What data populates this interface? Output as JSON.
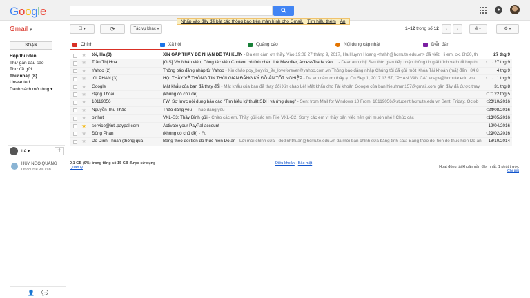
{
  "header": {
    "logo": "Google",
    "search_value": "",
    "promo_text": "Nhấp vào đây để bật các thông báo trên màn hình cho Gmail.",
    "promo_learn": "Tìm hiểu thêm",
    "promo_hide": "Ẩn"
  },
  "app": {
    "label": "Gmail",
    "label_arrow": "▾"
  },
  "toolbar": {
    "select_label": "☐ ▾",
    "refresh_label": "⟳",
    "more_label": "Tác vụ khác ▾",
    "pager_range": "1–12",
    "pager_of": "trong số",
    "pager_total": "12",
    "lang_label": "ê ▾",
    "settings_label": "⚙ ▾"
  },
  "sidebar": {
    "compose": "SOẠN",
    "items": [
      {
        "label": "Hộp thư đến",
        "active": true
      },
      {
        "label": "Thư gắn dấu sao",
        "active": false
      },
      {
        "label": "Thư đã gửi",
        "active": false
      },
      {
        "label": "Thư nháp (8)",
        "active": true
      },
      {
        "label": "Unwanted",
        "active": false
      },
      {
        "label": "Danh sách mở rộng ▾",
        "active": false
      }
    ],
    "hangouts_me": "Lê ▾",
    "contact_name": "HUY NGO QUANG",
    "contact_status": "Of course we can"
  },
  "tabs": [
    {
      "label": "Chính",
      "color": "#d93025"
    },
    {
      "label": "Xã hội",
      "color": "#1a73e8"
    },
    {
      "label": "Quảng cáo",
      "color": "#188038"
    },
    {
      "label": "Nội dung cập nhật",
      "color": "#e37400"
    },
    {
      "label": "Diễn đàn",
      "color": "#7b1fa2"
    }
  ],
  "emails": [
    {
      "sender": "tôi, Ha (3)",
      "subject": "XIN GẤP THẦY ĐỀ NHẬN ĐỀ TÀI KLTN",
      "snippet": " - Da em cảm ơn thầy. Vào 19:08 27 tháng 9, 2017, Ha Huynh Hoang <hahh@hcmute.edu.vn> đã viết: Hi em, ok. 8h30, th",
      "date": "27 thg 9",
      "unread": true,
      "starred": false,
      "attach": false
    },
    {
      "sender": "Trần Thị Hoa",
      "subject": "[G.S] V/v Nhân viên, Công tác viên Content có tính chén link Masoffer, AccessTrade vào ...",
      "snippet": " - Dear anh,chị! Sau thời gian tiếp nhận thông tin giải trình và buổi họp th",
      "date": "27 thg 9",
      "unread": false,
      "starred": false,
      "attach": true
    },
    {
      "sender": "Yahoo (2)",
      "subject": "Thông báo đăng nhập từ Yahoo",
      "snippet": " - Xin chào poy_boyvip_9x_loveforever@yahoo.com.vn Thông báo đăng nhập Chúng tôi đã gửi mớt Khóa Tài khoản (mã) đến +84 8",
      "date": "4 thg 9",
      "unread": false,
      "starred": false,
      "attach": false
    },
    {
      "sender": "tôi, PHAN (3)",
      "subject": "HỌI THẦY VỀ THÔNG TIN THỜI GIAN ĐĂNG KÝ ĐỒ ÁN TỐT NGHIỆP",
      "snippet": " - Da em cảm ơn thầy ạ. On Sep 1, 2017 13:57, \"PHAN VAN CA\" <capv@hcmute.edu.vn>",
      "date": "1 thg 9",
      "unread": false,
      "starred": false,
      "attach": true
    },
    {
      "sender": "Google",
      "subject": "Mật khẩu của bạn đã thay đổi",
      "snippet": " - Mật khẩu của bạn đã thay đổi Xin chào Lê! Mật khẩu cho Tài khoản Google của bạn hieuhmm157@gmail.com gần đây đã được thay",
      "date": "31 thg 8",
      "unread": false,
      "starred": false,
      "attach": false
    },
    {
      "sender": "Đặng Thoại",
      "subject": "(không có chủ đề)",
      "snippet": "",
      "date": "22 thg 5",
      "unread": false,
      "starred": false,
      "attach": true
    },
    {
      "sender": "10119056",
      "subject": "FW: Sơ lược nội dung báo cáo \"Tìm hiểu kỹ thuật SDH và ứng dụng\"",
      "snippet": " - Sent from Mail for Windows 10 From: 10119056@student.hcmute.edu.vn Sent: Friday, Octob",
      "date": "20/10/2016",
      "unread": false,
      "starred": false,
      "attach": true
    },
    {
      "sender": "Nguyễn Thu Thảo",
      "subject": "Thảo đáng yêu",
      "snippet": " - Thảo đáng yêu",
      "date": "24/08/2016",
      "unread": false,
      "starred": false,
      "attach": true
    },
    {
      "sender": "binhnt",
      "subject": "VXL-S3: Thầy Bình gửi",
      "snippet": " - Chào các em, Thầy gửi các em File VXL-C2. Sorry các em vì thầy bận việc nên gửi muộn nhé ! Chúc các",
      "date": "13/05/2016",
      "unread": false,
      "starred": false,
      "attach": true
    },
    {
      "sender": "service@intl.paypal.com",
      "subject": "Activate your PayPal account",
      "snippet": "",
      "date": "19/04/2016",
      "unread": false,
      "starred": true,
      "attach": false
    },
    {
      "sender": "Đông Phan",
      "subject": "(không có chủ đề)",
      "snippet": " - Fd",
      "date": "29/02/2016",
      "unread": false,
      "starred": false,
      "attach": true
    },
    {
      "sender": "Do Dinh Thuan (thông qua",
      "subject": "Bang theo doi tien do thuc hien Do an",
      "snippet": " - Lời mời chỉnh sửa - dodinhthuan@hcmute.edu.vn đã mời bạn chỉnh sửa bảng tính sau: Bang theo doi tien do thuc hien Do an",
      "date": "18/10/2014",
      "unread": false,
      "starred": false,
      "attach": false
    }
  ],
  "footer": {
    "storage": "0,1 GB (0%) trong tổng số 15 GB được sử dụng",
    "manage": "Quản lý",
    "terms": "Điều khoản",
    "privacy": "Bảo mật",
    "activity": "Hoạt động tài khoản gần đây nhất: 1 phút trước",
    "details": "Chi tiết"
  }
}
